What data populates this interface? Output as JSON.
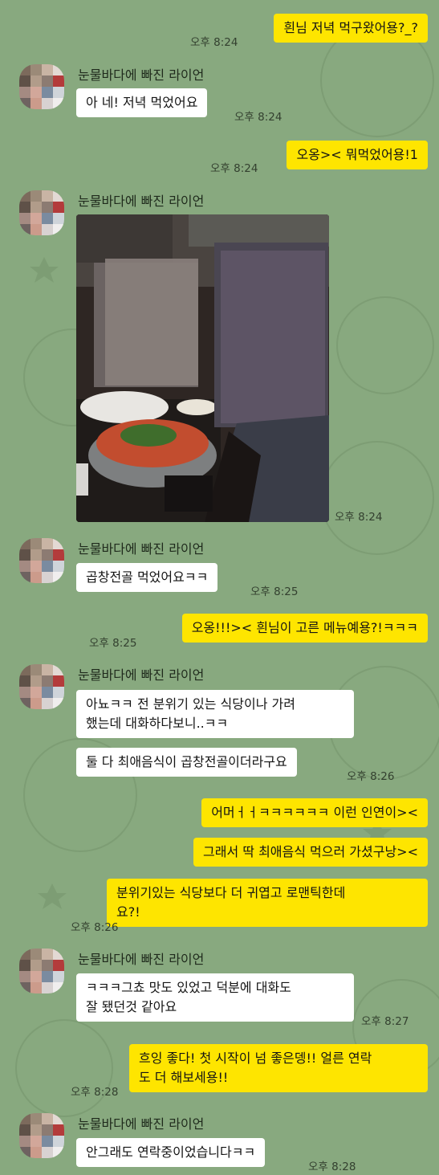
{
  "sender": {
    "name": "눈물바다에 빠진 라이언"
  },
  "messages": {
    "m1": {
      "text": "흰님 저녁 먹구왔어용?_?",
      "time": "오후 8:24"
    },
    "m2": {
      "text": "아 네! 저녁 먹었어요",
      "time": "오후 8:24"
    },
    "m3": {
      "text": "오옹>< 뭐먹었어용!1",
      "time": "오후 8:24"
    },
    "m4": {
      "time": "오후 8:24"
    },
    "m5": {
      "text": "곱창전골 먹었어요ㅋㅋ",
      "time": "오후 8:25"
    },
    "m6": {
      "text": "오옹!!!>< 흰님이 고른 메뉴예용?!ㅋㅋㅋ",
      "time": "오후 8:25"
    },
    "m7": {
      "text": "아뇨ㅋㅋ 전 분위기 있는 식당이나 가려\n했는데 대화하다보니..ㅋㅋ"
    },
    "m8": {
      "text": "둘 다 최애음식이 곱창전골이더라구요",
      "time": "오후 8:26"
    },
    "m9": {
      "text": "어머ㅓㅓㅋㅋㅋㅋㅋㅋ 이런 인연이><"
    },
    "m10": {
      "text": "그래서 딱 최애음식 먹으러 가셨구낭><"
    },
    "m11": {
      "text": "분위기있는 식당보다 더 귀엽고 로맨틱한데\n요?!",
      "time": "오후 8:26"
    },
    "m12": {
      "text": "ㅋㅋㅋ그쵸 맛도 있었고 덕분에 대화도\n잘 됐던것 같아요",
      "time": "오후 8:27"
    },
    "m13": {
      "text": "흐잉 좋다! 첫 시작이 넘 좋은뎅!! 얼른 연락\n도 더 해보세용!!",
      "time": "오후 8:28"
    },
    "m14": {
      "text": "안그래도 연락중이었습니다ㅋㅋ",
      "time": "오후 8:28"
    }
  },
  "colors": {
    "background": "#88a97f",
    "my_bubble": "#fee500",
    "their_bubble": "#ffffff"
  }
}
